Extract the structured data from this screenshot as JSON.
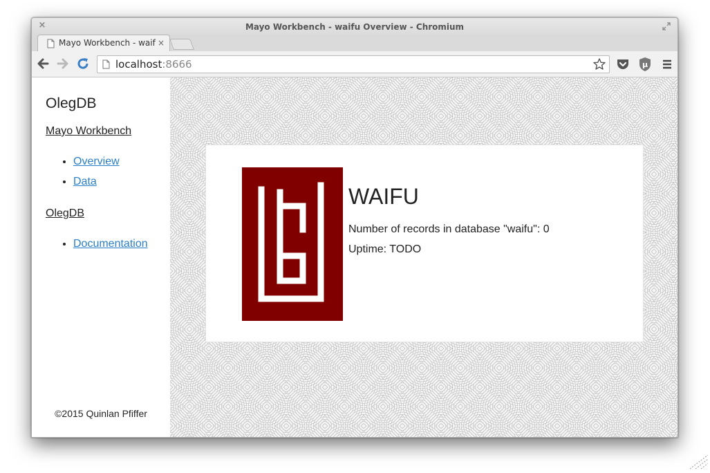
{
  "window": {
    "title": "Mayo Workbench - waifu Overview - Chromium",
    "close_glyph": "×"
  },
  "tab": {
    "title": "Mayo Workbench - waifu",
    "close_glyph": "×"
  },
  "omnibox": {
    "host": "localhost",
    "port": ":8666"
  },
  "sidebar": {
    "brand": "OlegDB",
    "sections": [
      {
        "heading": "Mayo Workbench",
        "links": [
          "Overview",
          "Data"
        ]
      },
      {
        "heading": "OlegDB",
        "links": [
          "Documentation"
        ]
      }
    ],
    "copyright": "©2015 Quinlan Pfiffer"
  },
  "main": {
    "db_name": "WAIFU",
    "record_count_text": "Number of records in database \"waifu\": 0",
    "uptime_text": "Uptime: TODO"
  },
  "colors": {
    "link": "#2a7fc8",
    "logo": "#800000"
  },
  "icons": {
    "back": "back-arrow-icon",
    "forward": "forward-arrow-icon",
    "reload": "reload-icon",
    "page": "page-icon",
    "bookmark": "star-icon",
    "pocket": "pocket-icon",
    "ublock": "ublock-icon",
    "menu": "hamburger-menu-icon"
  }
}
